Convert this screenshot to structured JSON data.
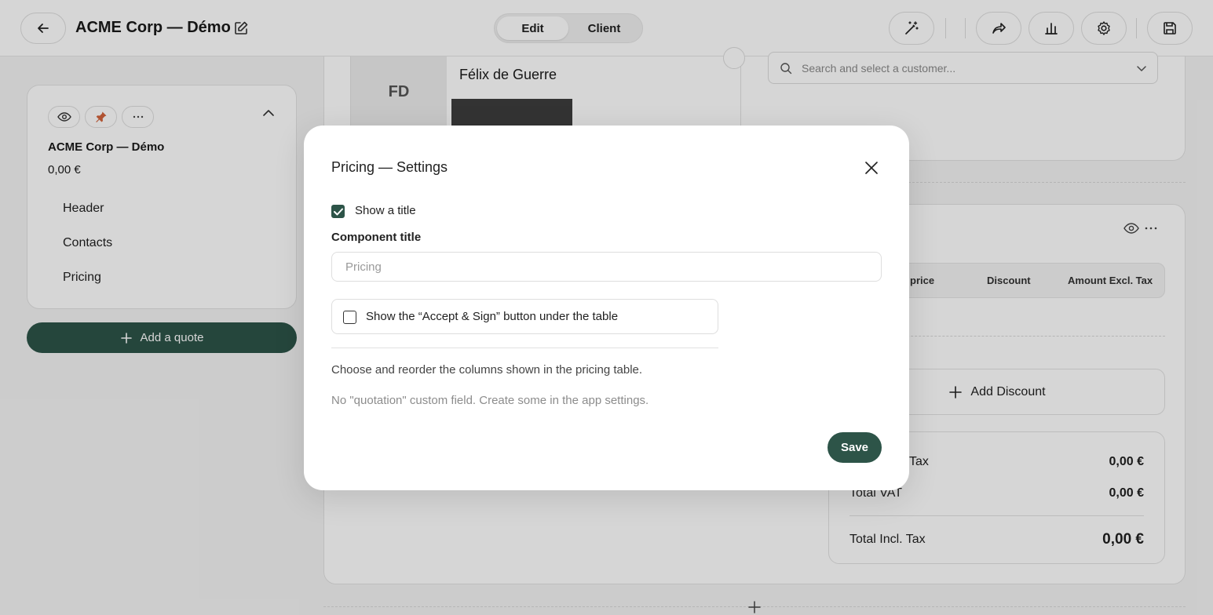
{
  "header": {
    "title": "ACME Corp — Démo",
    "modes": [
      {
        "label": "Edit",
        "active": true
      },
      {
        "label": "Client",
        "active": false
      }
    ]
  },
  "sidebar": {
    "quote_name": "ACME Corp — Démo",
    "quote_amount": "0,00 €",
    "items": [
      {
        "label": "Header"
      },
      {
        "label": "Contacts"
      },
      {
        "label": "Pricing"
      }
    ],
    "add_quote_label": "Add a quote",
    "pin_color": "#d2643c"
  },
  "contact": {
    "initials": "FD",
    "name": "Félix de Guerre"
  },
  "customer_search": {
    "placeholder": "Search and select a customer..."
  },
  "pricing_table": {
    "columns": [
      "price",
      "Discount",
      "Amount Excl. Tax"
    ],
    "add_discount_label": "Add Discount",
    "totals": [
      {
        "label": "Tax",
        "value": "0,00 €"
      },
      {
        "label": "Total VAT",
        "value": "0,00 €"
      },
      {
        "label": "Total Incl. Tax",
        "value": "0,00 €"
      }
    ]
  },
  "modal": {
    "title": "Pricing — Settings",
    "show_title_label": "Show a title",
    "show_title_checked": true,
    "component_title_label": "Component title",
    "component_title_placeholder": "Pricing",
    "component_title_value": "",
    "accept_sign_label": "Show the “Accept & Sign” button under the table",
    "accept_sign_checked": false,
    "help_text": "Choose and reorder the columns shown in the pricing table.",
    "no_fields_text": "No \"quotation\" custom field. Create some in the app settings.",
    "save_label": "Save"
  },
  "colors": {
    "brand": "#2d5448",
    "accent_pin": "#d2643c"
  }
}
